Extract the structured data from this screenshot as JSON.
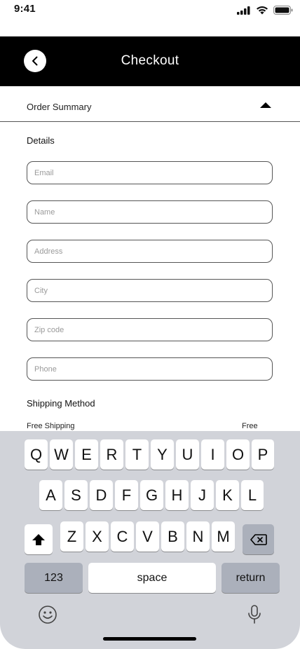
{
  "status_bar": {
    "time": "9:41"
  },
  "nav": {
    "title": "Checkout"
  },
  "order_summary": {
    "label": "Order Summary"
  },
  "details": {
    "heading": "Details"
  },
  "form": {
    "email": {
      "placeholder": "Email",
      "value": ""
    },
    "name": {
      "placeholder": "Name",
      "value": ""
    },
    "address": {
      "placeholder": "Address",
      "value": ""
    },
    "city": {
      "placeholder": "City",
      "value": ""
    },
    "zip": {
      "placeholder": "Zip code",
      "value": ""
    },
    "phone": {
      "placeholder": "Phone",
      "value": ""
    }
  },
  "shipping": {
    "heading": "Shipping Method",
    "option_label": "Free Shipping",
    "option_price": "Free"
  },
  "keyboard": {
    "row1": [
      "Q",
      "W",
      "E",
      "R",
      "T",
      "Y",
      "U",
      "I",
      "O",
      "P"
    ],
    "row2": [
      "A",
      "S",
      "D",
      "F",
      "G",
      "H",
      "J",
      "K",
      "L"
    ],
    "row3": [
      "Z",
      "X",
      "C",
      "V",
      "B",
      "N",
      "M"
    ],
    "numbers_label": "123",
    "space_label": "space",
    "return_label": "return",
    "icons": {
      "shift": "shift-icon",
      "delete": "delete-icon",
      "emoji": "emoji-icon",
      "mic": "microphone-icon"
    }
  },
  "icons": {
    "back": "chevron-left-icon",
    "order_toggle": "caret-up-icon",
    "signal": "cellular-signal-icon",
    "wifi": "wifi-icon",
    "battery": "battery-icon"
  }
}
